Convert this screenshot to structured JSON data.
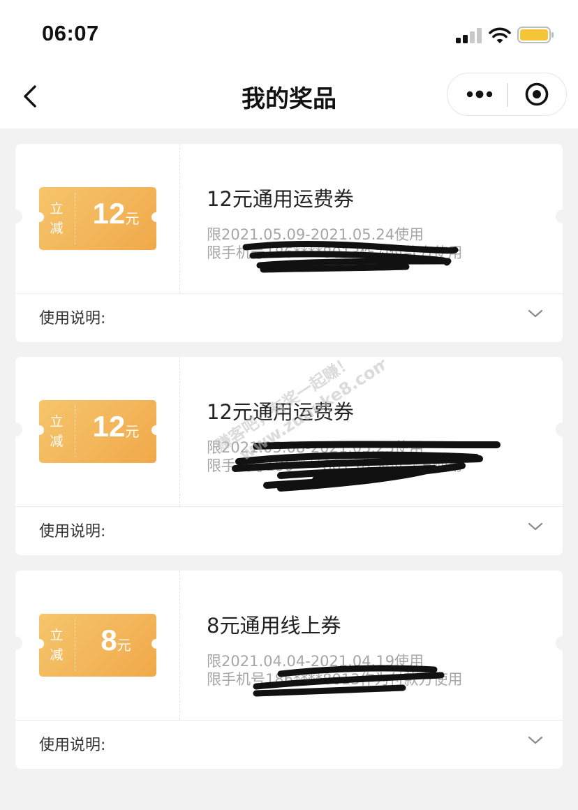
{
  "status_bar": {
    "time": "06:07"
  },
  "header": {
    "back_icon": "chevron-left-icon",
    "title": "我的奖品",
    "more_icon": "more-dots-icon",
    "close_icon": "target-circle-icon"
  },
  "coupons": [
    {
      "tag": "立减",
      "amount": "12",
      "unit": "元",
      "name": "12元通用运费券",
      "validity": "限2021.05.09-2021.05.24使用",
      "restriction": "限手机号186****8013作为付款方使用",
      "usage_label": "使用说明:"
    },
    {
      "tag": "立减",
      "amount": "12",
      "unit": "元",
      "name": "12元通用运费券",
      "validity": "限2021.05.08-2021.05.23使用",
      "restriction": "限手机号186****8013作为付款方使用",
      "usage_label": "使用说明:"
    },
    {
      "tag": "立减",
      "amount": "8",
      "unit": "元",
      "name": "8元通用线上券",
      "validity": "限2021.04.04-2021.04.19使用",
      "restriction": "限手机号186****8013作为付款方使用",
      "usage_label": "使用说明:"
    }
  ],
  "watermark": {
    "line1": "赚客吧，有奖一起赚！",
    "line2": "www.zuanke8.com"
  },
  "colors": {
    "ticket_start": "#f6c56c",
    "ticket_end": "#f0a94a",
    "background": "#f2f2f2"
  }
}
